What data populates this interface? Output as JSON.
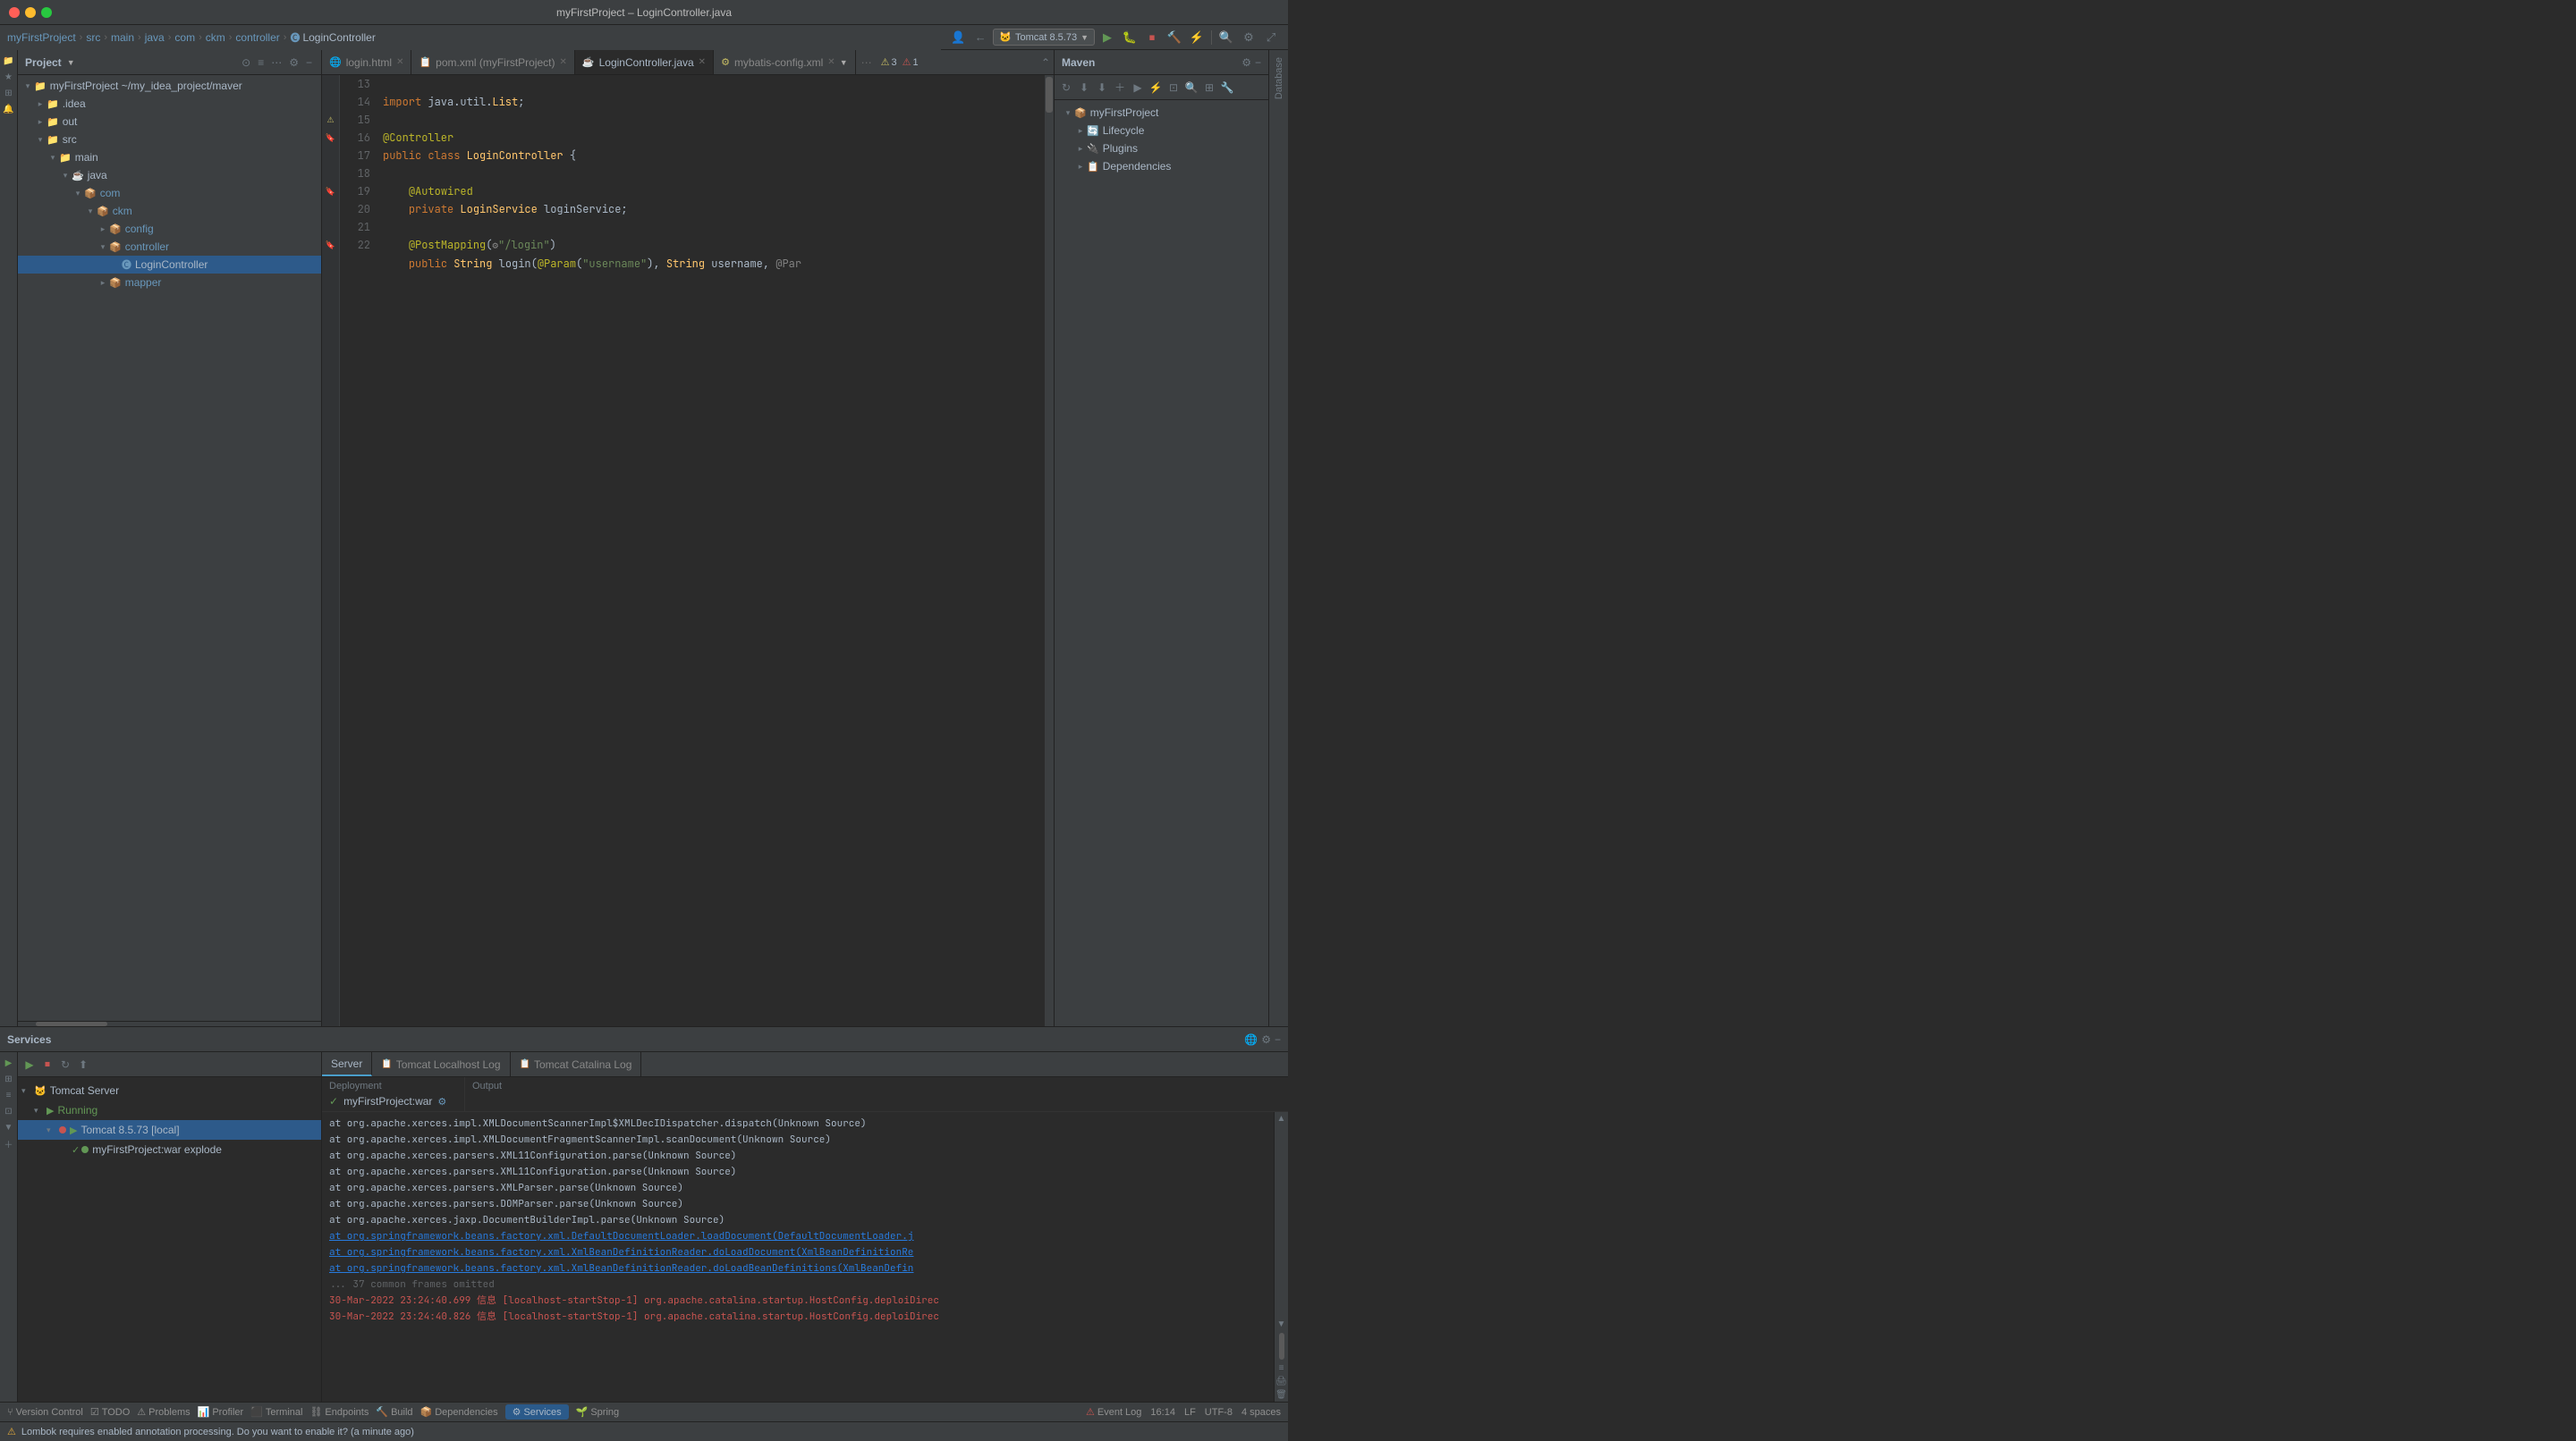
{
  "titleBar": {
    "title": "myFirstProject – LoginController.java"
  },
  "breadcrumb": {
    "items": [
      "myFirstProject",
      "src",
      "main",
      "java",
      "com",
      "ckm",
      "controller",
      "LoginController"
    ]
  },
  "toolbar": {
    "tomcatLabel": "Tomcat 8.5.73",
    "warningsCount": "3",
    "errorsCount": "1"
  },
  "projectPanel": {
    "title": "Project",
    "rootItem": "myFirstProject ~/my_idea_project/maver",
    "treeItems": [
      {
        "label": ".idea",
        "type": "folder",
        "depth": 1,
        "expanded": false
      },
      {
        "label": "out",
        "type": "folder",
        "depth": 1,
        "expanded": false
      },
      {
        "label": "src",
        "type": "folder",
        "depth": 1,
        "expanded": true
      },
      {
        "label": "main",
        "type": "folder",
        "depth": 2,
        "expanded": true
      },
      {
        "label": "java",
        "type": "folder",
        "depth": 3,
        "expanded": true
      },
      {
        "label": "com",
        "type": "pkg",
        "depth": 4,
        "expanded": true
      },
      {
        "label": "ckm",
        "type": "pkg",
        "depth": 5,
        "expanded": true
      },
      {
        "label": "config",
        "type": "pkg",
        "depth": 6,
        "expanded": false
      },
      {
        "label": "controller",
        "type": "pkg",
        "depth": 6,
        "expanded": true
      },
      {
        "label": "LoginController",
        "type": "class",
        "depth": 7,
        "selected": true
      },
      {
        "label": "mapper",
        "type": "pkg",
        "depth": 6,
        "expanded": false
      }
    ]
  },
  "editor": {
    "tabs": [
      {
        "label": "login.html",
        "active": false
      },
      {
        "label": "pom.xml (myFirstProject)",
        "active": false,
        "icon": "xml"
      },
      {
        "label": "LoginController.java",
        "active": true,
        "icon": "java"
      },
      {
        "label": "mybatis-config.xml",
        "active": false,
        "icon": "xml"
      }
    ],
    "lines": [
      {
        "num": 13,
        "code": "import java.util.List;",
        "gutter": ""
      },
      {
        "num": 14,
        "code": "",
        "gutter": ""
      },
      {
        "num": 15,
        "code": "@Controller",
        "gutter": "",
        "annotated": true
      },
      {
        "num": 16,
        "code": "public class LoginController {",
        "gutter": "bookmark"
      },
      {
        "num": 17,
        "code": "",
        "gutter": ""
      },
      {
        "num": 18,
        "code": "    @Autowired",
        "gutter": ""
      },
      {
        "num": 19,
        "code": "    private LoginService loginService;",
        "gutter": "bookmark"
      },
      {
        "num": 20,
        "code": "",
        "gutter": ""
      },
      {
        "num": 21,
        "code": "    @PostMapping(\"/login\")",
        "gutter": ""
      },
      {
        "num": 22,
        "code": "    public String login(@Param(\"username\"), String username, @Par",
        "gutter": "bookmark"
      }
    ]
  },
  "mavenPanel": {
    "title": "Maven",
    "items": [
      {
        "label": "myFirstProject",
        "depth": 0,
        "expanded": true,
        "icon": "maven"
      },
      {
        "label": "Lifecycle",
        "depth": 1,
        "expanded": false
      },
      {
        "label": "Plugins",
        "depth": 1,
        "expanded": false
      },
      {
        "label": "Dependencies",
        "depth": 1,
        "expanded": false
      }
    ]
  },
  "rightTabs": [
    "Database"
  ],
  "servicesPanel": {
    "title": "Services",
    "treeItems": [
      {
        "label": "Tomcat Server",
        "depth": 0,
        "expanded": true,
        "icon": "tomcat"
      },
      {
        "label": "Running",
        "depth": 1,
        "expanded": true,
        "status": "running"
      },
      {
        "label": "Tomcat 8.5.73 [local]",
        "depth": 2,
        "expanded": true,
        "status": "running",
        "selected": true
      },
      {
        "label": "myFirstProject:war explode",
        "depth": 3,
        "status": "ok"
      }
    ]
  },
  "outputTabs": [
    {
      "label": "Server",
      "active": true
    },
    {
      "label": "Tomcat Localhost Log",
      "active": false
    },
    {
      "label": "Tomcat Catalina Log",
      "active": false
    }
  ],
  "deployment": {
    "label": "Deployment",
    "outputLabel": "Output",
    "items": [
      {
        "name": "myFirstProject:war",
        "status": "ok"
      }
    ]
  },
  "outputLines": [
    {
      "text": "  at org.apache.xerces.impl.XMLDocumentScannerImpl$XMLDecIDispatcher.dispatch(Unknown Source)",
      "type": "normal"
    },
    {
      "text": "  at org.apache.xerces.impl.XMLDocumentFragmentScannerImpl.scanDocument(Unknown Source)",
      "type": "normal"
    },
    {
      "text": "  at org.apache.xerces.parsers.XML11Configuration.parse(Unknown Source)",
      "type": "normal"
    },
    {
      "text": "  at org.apache.xerces.parsers.XML11Configuration.parse(Unknown Source)",
      "type": "normal"
    },
    {
      "text": "  at org.apache.xerces.parsers.XMLParser.parse(Unknown Source)",
      "type": "normal"
    },
    {
      "text": "  at org.apache.xerces.parsers.DOMParser.parse(Unknown Source)",
      "type": "normal"
    },
    {
      "text": "  at org.apache.xerces.jaxp.DocumentBuilderImpl.parse(Unknown Source)",
      "type": "normal"
    },
    {
      "text": "  at org.springframework.beans.factory.xml.DefaultDocumentLoader.loadDocument(DefaultDocumentLoader.j",
      "type": "link"
    },
    {
      "text": "  at org.springframework.beans.factory.xml.XmlBeanDefinitionReader.doLoadDocument(XmlBeanDefinitionRe",
      "type": "link"
    },
    {
      "text": "  at org.springframework.beans.factory.xml.XmlBeanDefinitionReader.doLoadBeanDefinitions(XmlBeanDefin",
      "type": "link"
    },
    {
      "text": "  ... 37 common frames omitted",
      "type": "ellipsis"
    },
    {
      "text": "30-Mar-2022 23:24:40.699 信息 [localhost-startStop-1] org.apache.catalina.startup.HostConfig.deploiDirec",
      "type": "error"
    },
    {
      "text": "30-Mar-2022 23:24:40.826 信息 [localhost-startStop-1] org.apache.catalina.startup.HostConfig.deploiDirec",
      "type": "error"
    }
  ],
  "statusBar": {
    "items": [
      {
        "label": "Version Control",
        "icon": "vcs",
        "active": false
      },
      {
        "label": "TODO",
        "icon": "todo",
        "active": false
      },
      {
        "label": "Problems",
        "icon": "problems",
        "active": false
      },
      {
        "label": "Profiler",
        "icon": "profiler",
        "active": false
      },
      {
        "label": "Terminal",
        "icon": "terminal",
        "active": false
      },
      {
        "label": "Endpoints",
        "icon": "endpoints",
        "active": false
      },
      {
        "label": "Build",
        "icon": "build",
        "active": false
      },
      {
        "label": "Dependencies",
        "icon": "deps",
        "active": false
      },
      {
        "label": "Services",
        "icon": "services",
        "active": true
      },
      {
        "label": "Spring",
        "icon": "spring",
        "active": false
      }
    ],
    "rightInfo": {
      "line": "16:14",
      "encoding": "UTF-8",
      "indent": "4 spaces",
      "eventLog": "Event Log"
    }
  },
  "notification": {
    "text": "Lombok requires enabled annotation processing. Do you want to enable it? (a minute ago)"
  }
}
